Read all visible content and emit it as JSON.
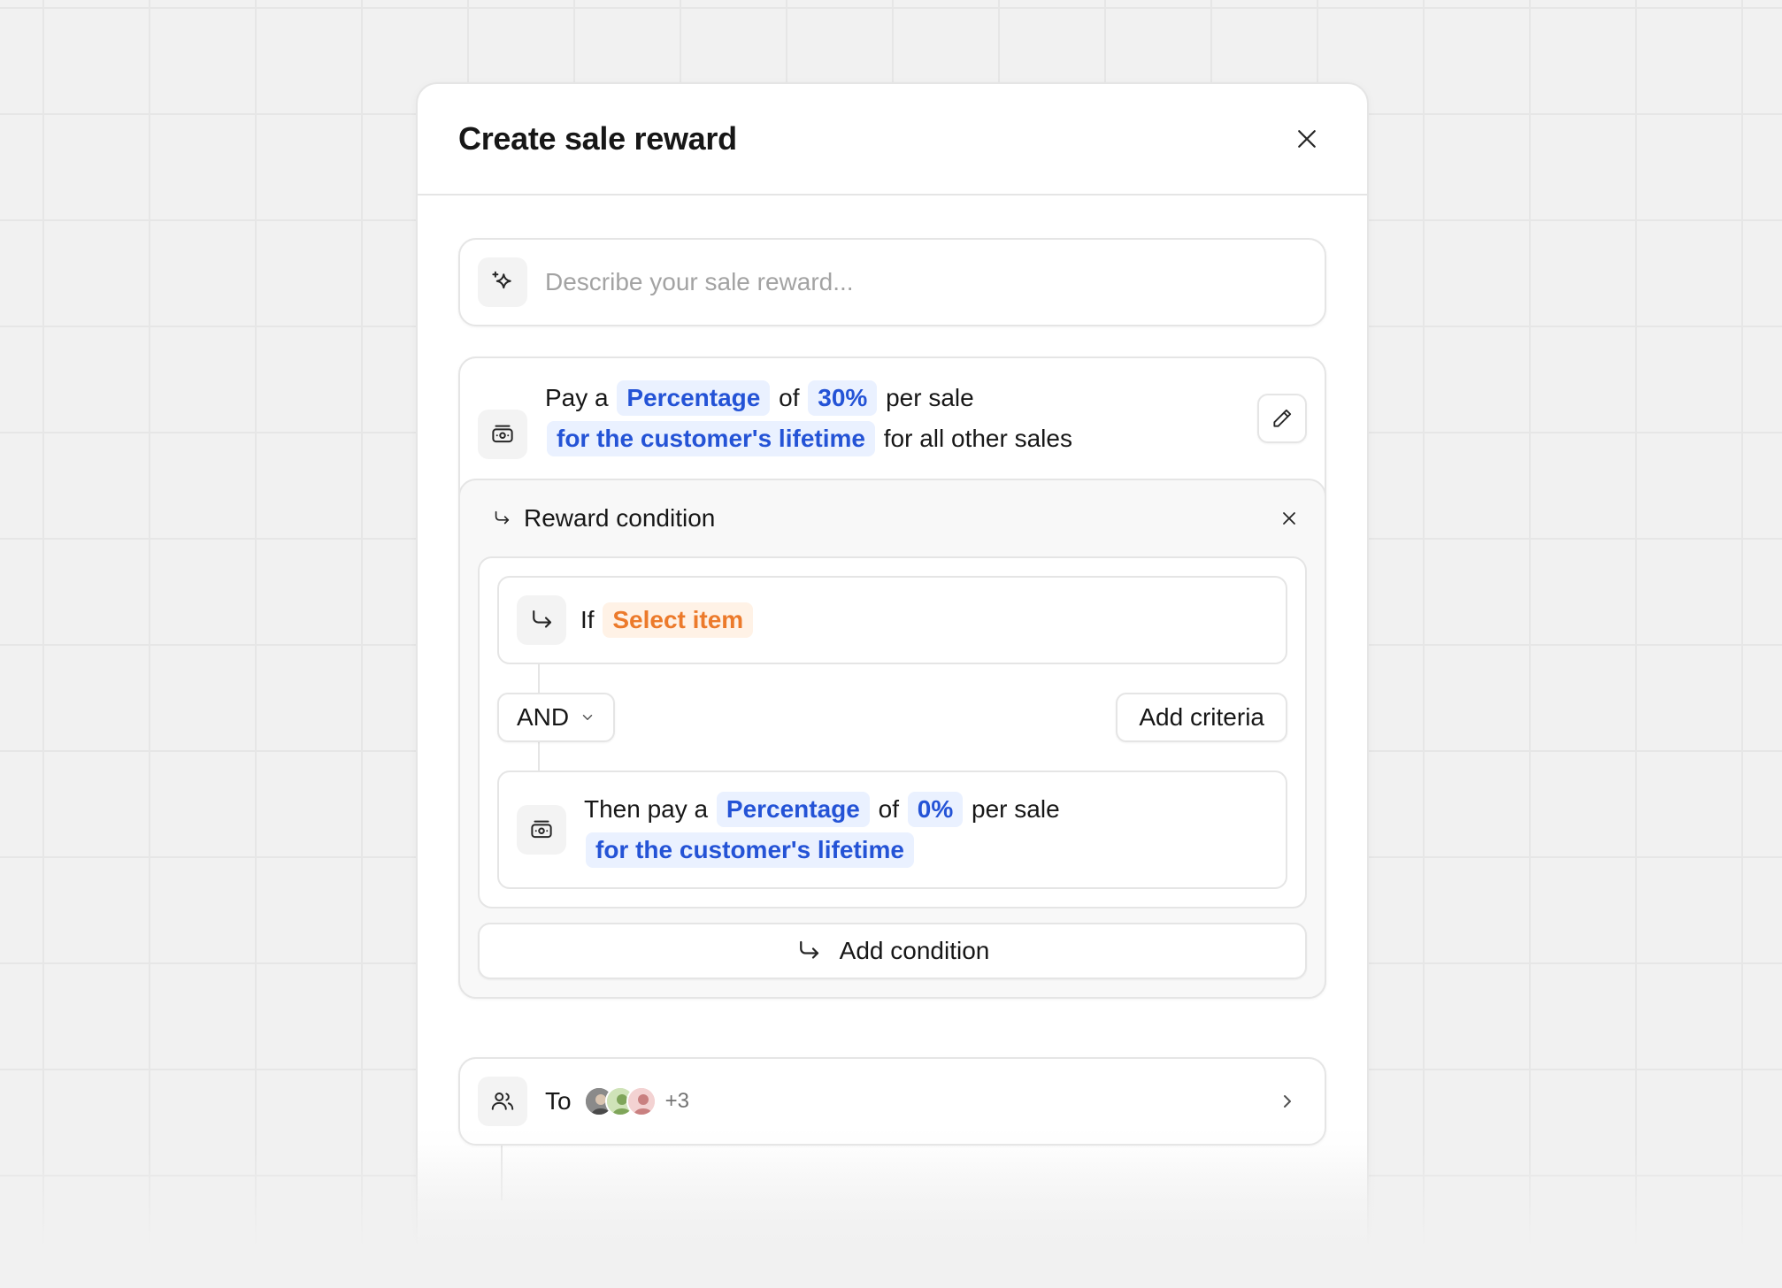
{
  "modal": {
    "title": "Create sale reward"
  },
  "describe": {
    "placeholder": "Describe your sale reward..."
  },
  "reward": {
    "prefix": "Pay a",
    "type_chip": "Percentage",
    "of": "of",
    "amount_chip": "30%",
    "per": "per sale",
    "duration_chip": "for the customer's lifetime",
    "suffix": "for all other sales"
  },
  "condition": {
    "header": "Reward condition",
    "if_label": "If",
    "select_chip": "Select item",
    "operator": "AND",
    "add_criteria": "Add criteria",
    "then": {
      "prefix": "Then pay a",
      "type_chip": "Percentage",
      "of": "of",
      "amount_chip": "0%",
      "per": "per sale",
      "duration_chip": "for the customer's lifetime"
    },
    "add_condition": "Add condition"
  },
  "recipients": {
    "label": "To",
    "more": "+3"
  },
  "colors": {
    "chip_blue_bg": "#eaf1ff",
    "chip_blue_text": "#2453d6",
    "chip_orange_bg": "#fff2e6",
    "chip_orange_text": "#ec7a2b"
  },
  "icons": [
    "close-icon",
    "sparkles-icon",
    "money-icon",
    "pencil-icon",
    "arrow-return-icon",
    "chevron-down-icon",
    "users-icon",
    "chevron-right-icon"
  ]
}
